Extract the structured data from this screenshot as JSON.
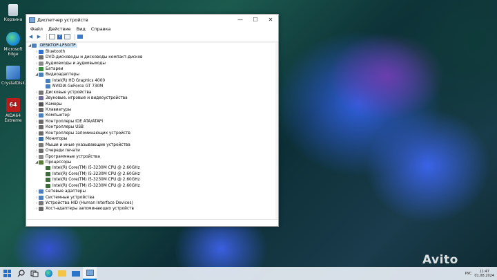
{
  "desktop": {
    "icons": [
      {
        "label": "Корзина"
      },
      {
        "label": "Microsoft Edge"
      },
      {
        "label": "CrystalDisk..."
      },
      {
        "label": "AIDA64 Extreme"
      }
    ]
  },
  "window": {
    "title": "Диспетчер устройств",
    "menu": [
      "Файл",
      "Действие",
      "Вид",
      "Справка"
    ],
    "tree": {
      "root": "DESKTOP-LP50ITP",
      "items": [
        {
          "label": "Bluetooth",
          "expanded": false
        },
        {
          "label": "DVD-дисководы и дисководы компакт-дисков",
          "expanded": false
        },
        {
          "label": "Аудиовходы и аудиовыходы",
          "expanded": false
        },
        {
          "label": "Батареи",
          "expanded": false
        },
        {
          "label": "Видеоадаптеры",
          "expanded": true,
          "children": [
            "Intel(R) HD Graphics 4000",
            "NVIDIA GeForce GT 730M"
          ]
        },
        {
          "label": "Дисковые устройства",
          "expanded": false
        },
        {
          "label": "Звуковые, игровые и видеоустройства",
          "expanded": false
        },
        {
          "label": "Камеры",
          "expanded": false
        },
        {
          "label": "Клавиатуры",
          "expanded": false
        },
        {
          "label": "Компьютер",
          "expanded": false
        },
        {
          "label": "Контроллеры IDE ATA/ATAPI",
          "expanded": false
        },
        {
          "label": "Контроллеры USB",
          "expanded": false
        },
        {
          "label": "Контроллеры запоминающих устройств",
          "expanded": false
        },
        {
          "label": "Мониторы",
          "expanded": false
        },
        {
          "label": "Мыши и иные указывающие устройства",
          "expanded": false
        },
        {
          "label": "Очереди печати",
          "expanded": false
        },
        {
          "label": "Программные устройства",
          "expanded": false
        },
        {
          "label": "Процессоры",
          "expanded": true,
          "children": [
            "Intel(R) Core(TM) i5-3230M CPU @ 2.60GHz",
            "Intel(R) Core(TM) i5-3230M CPU @ 2.60GHz",
            "Intel(R) Core(TM) i5-3230M CPU @ 2.60GHz",
            "Intel(R) Core(TM) i5-3230M CPU @ 2.60GHz"
          ]
        },
        {
          "label": "Сетевые адаптеры",
          "expanded": false
        },
        {
          "label": "Системные устройства",
          "expanded": false
        },
        {
          "label": "Устройства HID (Human Interface Devices)",
          "expanded": false
        },
        {
          "label": "Хост-адаптеры запоминающих устройств",
          "expanded": false
        }
      ]
    }
  },
  "taskbar": {
    "language": "РУС",
    "time": "11:47",
    "date": "01.08.2024"
  },
  "watermark": "Avito",
  "colors": {
    "selection": "#cce4f7",
    "accent": "#0078d7"
  }
}
